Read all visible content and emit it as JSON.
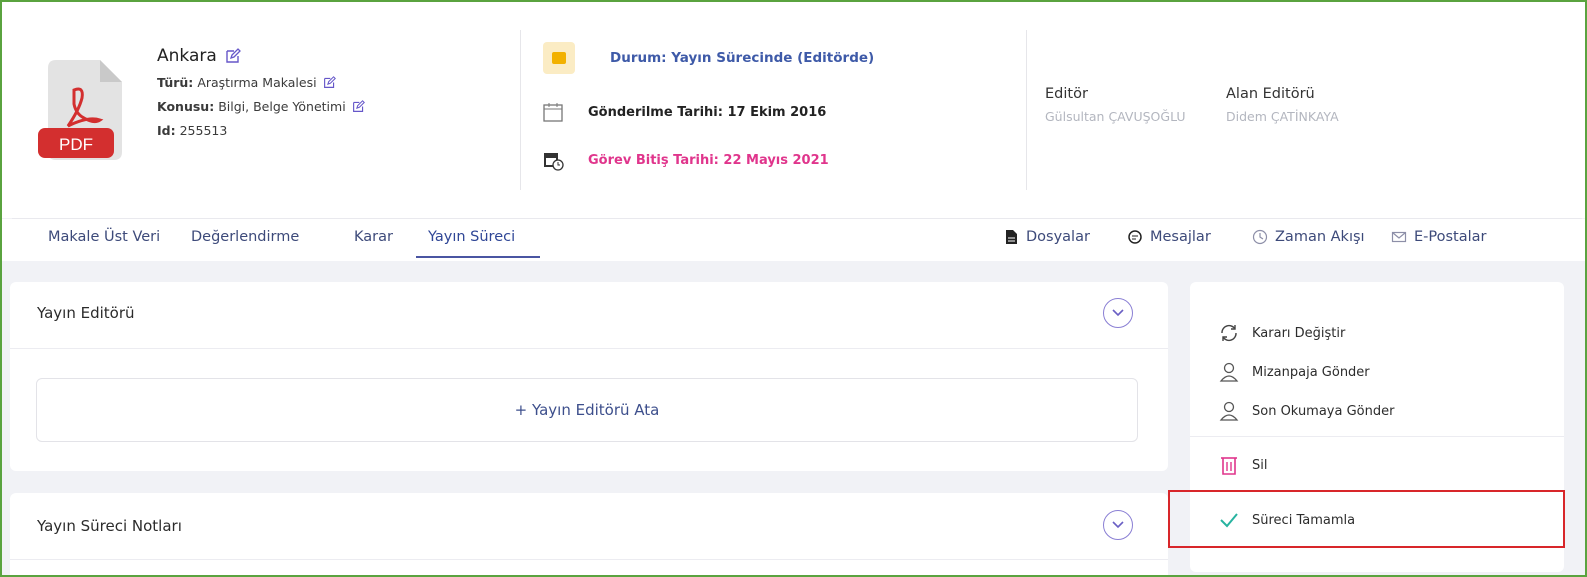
{
  "article": {
    "title": "Ankara",
    "type_label": "Türü:",
    "type_value": "Araştırma Makalesi",
    "topic_label": "Konusu:",
    "topic_value": "Bilgi, Belge Yönetimi",
    "id_label": "Id:",
    "id_value": "255513",
    "file_icon_text": "PDF"
  },
  "status": {
    "text": "Durum: Yayın Sürecinde (Editörde)",
    "sent_date": "Gönderilme Tarihi: 17 Ekim 2016",
    "due_date": "Görev Bitiş Tarihi: 22 Mayıs 2021"
  },
  "editors": {
    "editor_label": "Editör",
    "editor_name": "Gülsultan ÇAVUŞOĞLU",
    "field_editor_label": "Alan Editörü",
    "field_editor_name": "Didem ÇATİNKAYA"
  },
  "tabs": {
    "left": [
      "Makale Üst Veri",
      "Değerlendirme",
      "Karar",
      "Yayın Süreci"
    ],
    "right": [
      "Dosyalar",
      "Mesajlar",
      "Zaman Akışı",
      "E-Postalar"
    ],
    "active": "Yayın Süreci"
  },
  "cards": {
    "publication_editor_title": "Yayın Editörü",
    "assign_label": "+ Yayın Editörü Ata",
    "notes_title": "Yayın Süreci Notları"
  },
  "actions": {
    "change_decision": "Kararı Değiştir",
    "send_layout": "Mizanpaja Gönder",
    "send_proofread": "Son Okumaya Gönder",
    "delete": "Sil",
    "complete": "Süreci Tamamla"
  },
  "colors": {
    "accent": "#3e5aa8",
    "due_date": "#e0358c",
    "highlight": "#d8262a",
    "outer_border": "#5aa33f"
  }
}
